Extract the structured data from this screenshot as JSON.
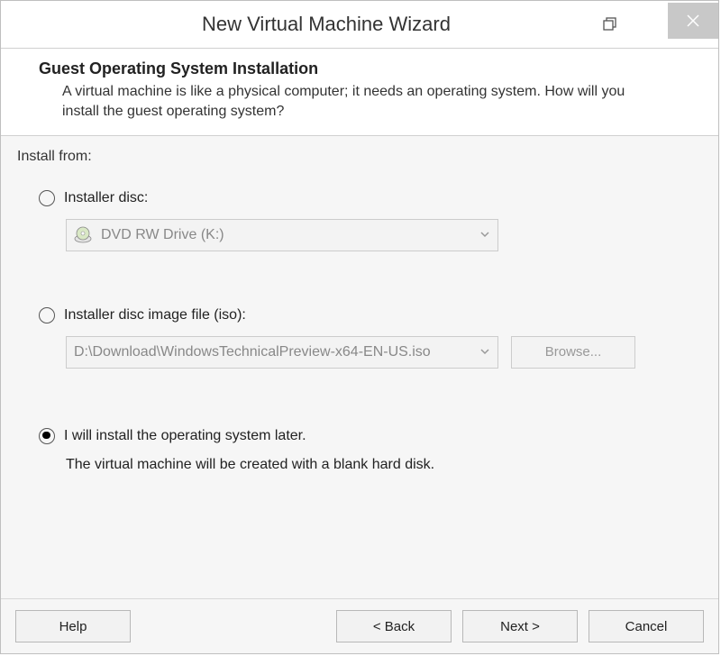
{
  "window": {
    "title": "New Virtual Machine Wizard"
  },
  "header": {
    "heading": "Guest Operating System Installation",
    "subtext": "A virtual machine is like a physical computer; it needs an operating system. How will you install the guest operating system?"
  },
  "content": {
    "install_from_label": "Install from:",
    "options": {
      "disc": {
        "label": "Installer disc:",
        "drive": "DVD RW Drive (K:)",
        "selected": false
      },
      "iso": {
        "label": "Installer disc image file (iso):",
        "path": "D:\\Download\\WindowsTechnicalPreview-x64-EN-US.iso",
        "browse": "Browse...",
        "selected": false
      },
      "later": {
        "label": "I will install the operating system later.",
        "description": "The virtual machine will be created with a blank hard disk.",
        "selected": true
      }
    }
  },
  "footer": {
    "help": "Help",
    "back": "< Back",
    "next": "Next >",
    "cancel": "Cancel"
  }
}
